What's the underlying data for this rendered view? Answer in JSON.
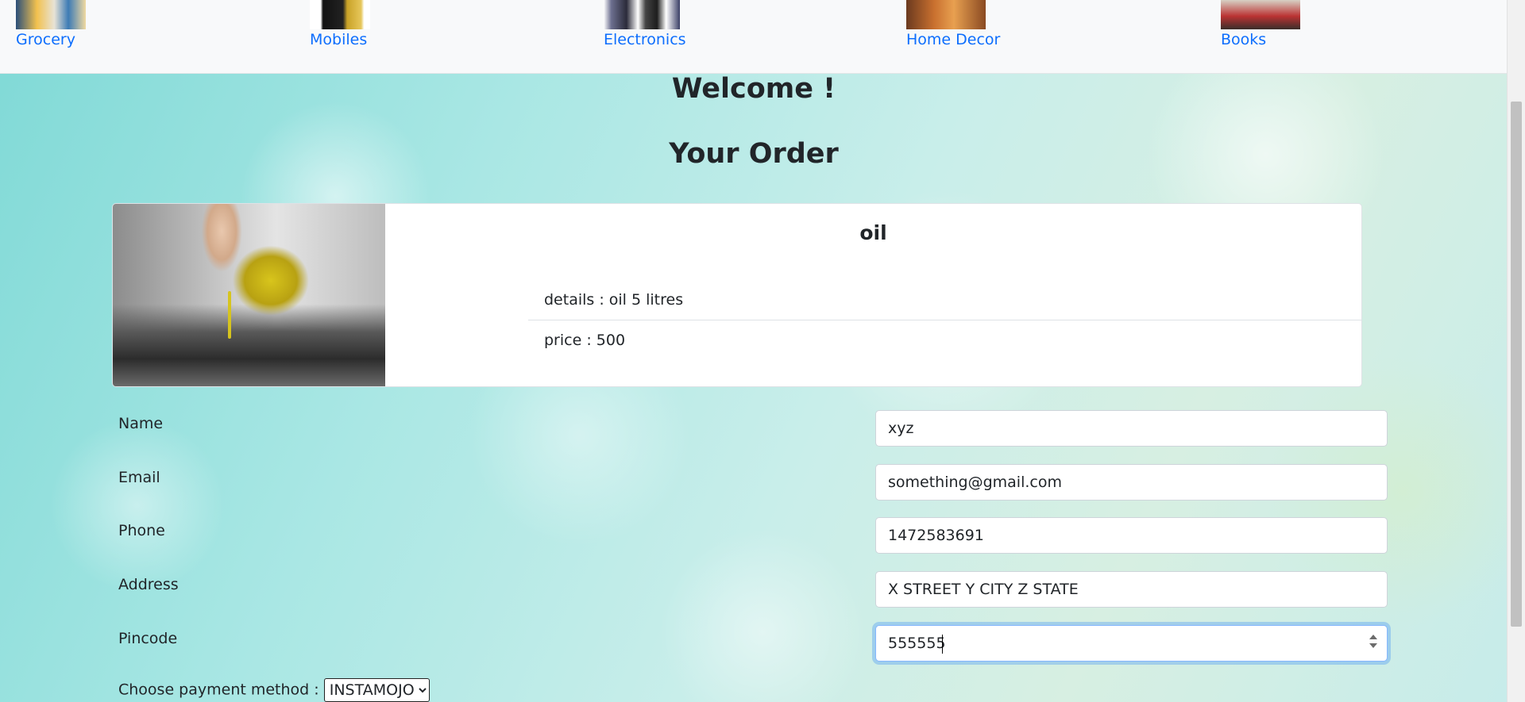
{
  "nav": {
    "categories": [
      {
        "label": "Grocery",
        "icon": "grocery-thumbnail"
      },
      {
        "label": "Mobiles",
        "icon": "mobiles-thumbnail"
      },
      {
        "label": "Electronics",
        "icon": "electronics-thumbnail"
      },
      {
        "label": "Home Decor",
        "icon": "home-decor-thumbnail"
      },
      {
        "label": "Books",
        "icon": "books-thumbnail"
      }
    ],
    "link_color": "#0d6efd"
  },
  "page": {
    "welcome": "Welcome !",
    "heading": "Your Order"
  },
  "product": {
    "name": "oil",
    "details": "details : oil 5 litres",
    "price": "price : 500",
    "image": "oil-pouring-image"
  },
  "form": {
    "fields": [
      {
        "label": "Name",
        "value": "xyz"
      },
      {
        "label": "Email",
        "value": "something@gmail.com"
      },
      {
        "label": "Phone",
        "value": "1472583691"
      },
      {
        "label": "Address",
        "value": "X STREET Y CITY Z STATE"
      },
      {
        "label": "Pincode",
        "value": "555555"
      }
    ],
    "payment": {
      "label": "Choose payment method :",
      "selected": "INSTAMOJO"
    }
  }
}
